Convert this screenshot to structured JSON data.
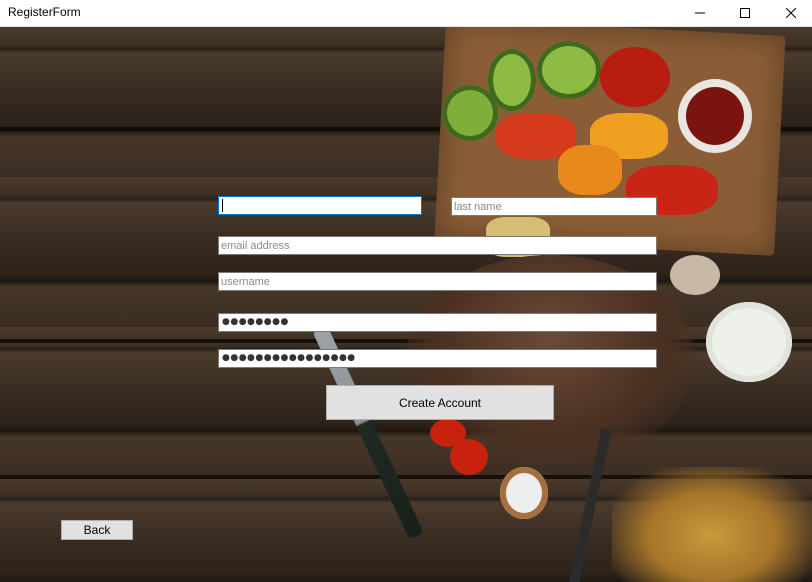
{
  "window": {
    "title": "RegisterForm",
    "controls": {
      "minimize": "minimize-icon",
      "maximize": "maximize-icon",
      "close": "close-icon"
    }
  },
  "form": {
    "first_name": {
      "value": "",
      "placeholder": ""
    },
    "last_name": {
      "value": "",
      "placeholder": "last name"
    },
    "email": {
      "value": "",
      "placeholder": "email address"
    },
    "username": {
      "value": "",
      "placeholder": "username"
    },
    "password": {
      "masked": "●●●●●●●●"
    },
    "confirm_password": {
      "masked": "●●●●●●●●●●●●●●●●"
    },
    "create_account_label": "Create Account",
    "back_label": "Back"
  }
}
